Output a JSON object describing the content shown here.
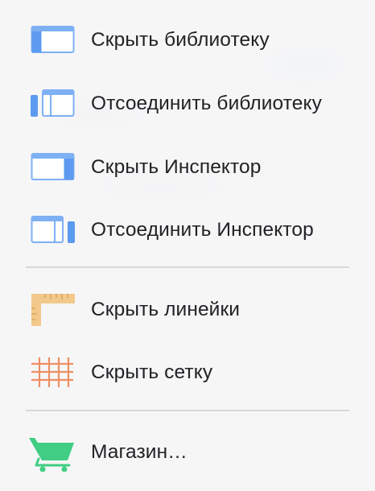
{
  "menu": {
    "items": [
      {
        "label": "Скрыть библиотеку",
        "icon": "library-panel-icon"
      },
      {
        "label": "Отсоединить библиотеку",
        "icon": "detach-library-icon"
      },
      {
        "label": "Скрыть Инспектор",
        "icon": "inspector-panel-icon"
      },
      {
        "label": "Отсоединить Инспектор",
        "icon": "detach-inspector-icon"
      },
      {
        "label": "Скрыть линейки",
        "icon": "ruler-icon"
      },
      {
        "label": "Скрыть сетку",
        "icon": "grid-icon"
      },
      {
        "label": "Магазин…",
        "icon": "shopping-cart-icon"
      }
    ]
  },
  "colors": {
    "panel_blue": "#5c9bf0",
    "panel_blue_light": "#8ab8f7",
    "ruler": "#f2c98a",
    "grid": "#ee8f63",
    "cart": "#41cd84",
    "text": "#222226",
    "separator": "#d9d9db"
  }
}
